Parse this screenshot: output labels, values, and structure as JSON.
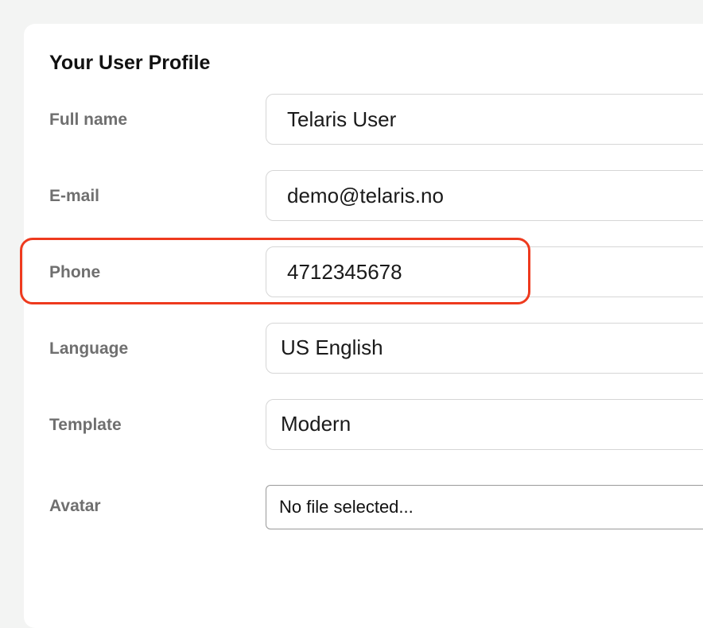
{
  "profile": {
    "title": "Your User Profile",
    "full_name": {
      "label": "Full name",
      "value": "Telaris User"
    },
    "email": {
      "label": "E-mail",
      "value": "demo@telaris.no"
    },
    "phone": {
      "label": "Phone",
      "value": "4712345678"
    },
    "language": {
      "label": "Language",
      "value": "US English"
    },
    "template": {
      "label": "Template",
      "value": "Modern"
    },
    "avatar": {
      "label": "Avatar",
      "value": "No file selected..."
    }
  },
  "colors": {
    "highlight": "#ee3a1e",
    "label": "#6f6f6f",
    "border": "#d6d6d6"
  }
}
